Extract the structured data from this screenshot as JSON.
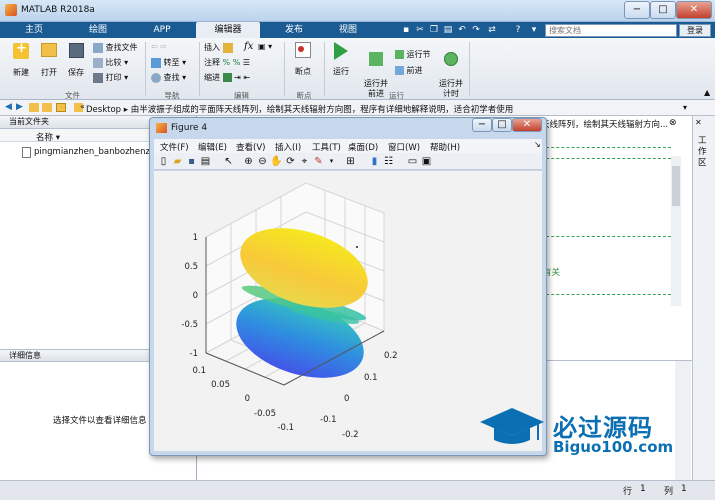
{
  "window": {
    "title": "MATLAB R2018a"
  },
  "tabs": [
    {
      "label": "主页"
    },
    {
      "label": "绘图"
    },
    {
      "label": "APP"
    },
    {
      "label": "编辑器"
    },
    {
      "label": "发布"
    },
    {
      "label": "视图"
    }
  ],
  "search": {
    "placeholder": "搜索文档",
    "login": "登录"
  },
  "ribbon": {
    "file": {
      "new": "新建",
      "open": "打开",
      "save": "保存",
      "find_file": "查找文件",
      "compare": "比较",
      "print": "打印",
      "group": "文件"
    },
    "nav": {
      "goto": "转至",
      "find": "查找",
      "group": "导航"
    },
    "edit": {
      "insert": "插入",
      "comment": "注释",
      "indent": "缩进",
      "fx": "fx",
      "group": "编辑"
    },
    "breakpoints": {
      "label": "断点",
      "group": "断点"
    },
    "run": {
      "run": "运行",
      "run_advance": "运行并\n前进",
      "run_section": "运行节",
      "advance": "前进",
      "run_time": "运行并\n计时",
      "group": "运行"
    }
  },
  "address": {
    "path": "Desktop ▸ 由半波振子组成的平面阵天线阵列，绘制其天线辐射方向图，程序有详细地解释说明，适合初学者使用"
  },
  "current_folder": {
    "title": "当前文件夹",
    "col_name": "名称 ▾",
    "files": [
      "pingmianzhen_banbozhenzi.m"
    ]
  },
  "details": {
    "title": "详细信息",
    "hint": "选择文件以查看详细信息"
  },
  "editor": {
    "tab_title": "天线阵列，绘制其天线辐射方向...",
    "snippet": "有关",
    "workspace_label": "工作区"
  },
  "status": {
    "row_label": "行",
    "row": "1",
    "col_label": "列",
    "col": "1"
  },
  "figure": {
    "title": "Figure 4",
    "menu": [
      "文件(F)",
      "编辑(E)",
      "查看(V)",
      "插入(I)",
      "工具(T)",
      "桌面(D)",
      "窗口(W)",
      "帮助(H)"
    ],
    "z_ticks": [
      "1",
      "0.5",
      "0",
      "-0.5",
      "-1"
    ],
    "y_ticks": [
      "0.1",
      "0.05",
      "0",
      "-0.05",
      "-0.1"
    ],
    "x_ticks": [
      "0.2",
      "0.1",
      "0",
      "-0.1",
      "-0.2"
    ]
  },
  "watermark": {
    "brand": "必过源码",
    "url": "Biguo100.com"
  },
  "colors": {
    "tab_bar": "#1b5b94",
    "accent": "#0b6fb3"
  }
}
